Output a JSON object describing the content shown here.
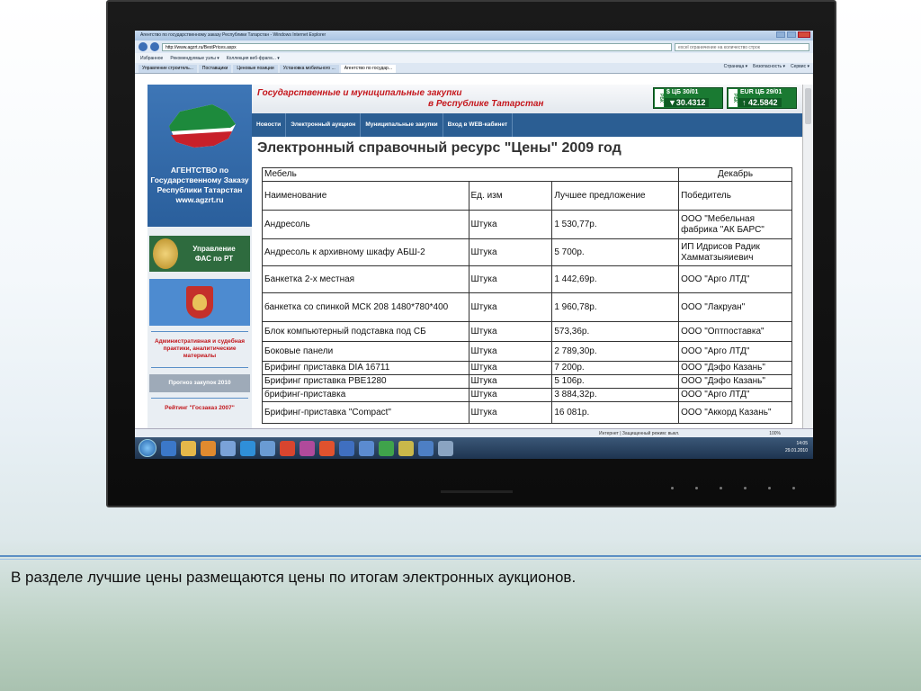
{
  "slide": {
    "caption": "В разделе лучшие цены размещаются цены по итогам электронных аукционов."
  },
  "browser": {
    "window_title": "Агентство по государственному заказу Республики Татарстан - Windows Internet Explorer",
    "url": "http://www.agzrt.ru/BestPrices.aspx",
    "search_text": "excel ограничение на количество строк",
    "favorites": [
      "Избранное",
      "Рекомендуемые узлы ▾",
      "Коллекция веб-фрагм... ▾"
    ],
    "tabs": [
      "Управление строитель...",
      "Поставщики",
      "Ценовые позиции",
      "Установка мобильного ...",
      "Агентство по государ..."
    ],
    "command_items": [
      "Страница ▾",
      "Безопасность ▾",
      "Сервис ▾"
    ],
    "status_text": "Интернет | Защищенный режим: выкл.",
    "zoom": "100%"
  },
  "taskbar": {
    "time": "14:05",
    "date": "29.01.2010"
  },
  "site": {
    "banner_line1": "Государственные и муниципальные закупки",
    "banner_line2": "в Республике Татарстан",
    "rates": [
      {
        "label": "$ ЦБ",
        "date": "30/01",
        "value": "▼30.4312",
        "tag": "РБК"
      },
      {
        "label": "EUR ЦБ",
        "date": "29/01",
        "value": "↑ 42.5842",
        "tag": "РБК"
      }
    ],
    "menu": [
      "Новости",
      "Электронный аукцион",
      "Муниципальные закупки",
      "Вход в WEB-кабинет"
    ],
    "sidebar": {
      "agency_lines": [
        "АГЕНТСТВО по",
        "Государственному Заказу",
        "Республики Татарстан",
        "www.agzrt.ru"
      ],
      "fas_lines": [
        "Управление",
        "ФАС по РТ"
      ],
      "links": [
        "Административная и судебная практики, аналитические материалы",
        "Прогноз закупок 2010",
        "Рейтинг \"Госзаказ 2007\""
      ]
    },
    "page_title": "Электронный справочный ресурс \"Цены\" 2009 год",
    "table": {
      "category": "Мебель",
      "month": "Декабрь",
      "headers": [
        "Наименование",
        "Ед. изм",
        "Лучшее предложение",
        "Победитель"
      ],
      "rows": [
        [
          "Андресоль",
          "Штука",
          "1 530,77р.",
          "ООО \"Мебельная фабрика \"АК БАРС\""
        ],
        [
          "Андресоль к архивному шкафу АБШ-2",
          "Штука",
          "5 700р.",
          "ИП Идрисов Радик Хамматзыяиевич"
        ],
        [
          "Банкетка 2-х местная",
          "Штука",
          "1 442,69р.",
          "ООО \"Арго ЛТД\""
        ],
        [
          "банкетка со спинкой МСК 208 1480*780*400",
          "Штука",
          "1 960,78р.",
          "ООО \"Лакруан\""
        ],
        [
          "Блок компьютерный подставка под СБ",
          "Штука",
          "573,36р.",
          "ООО \"Оптпоставка\""
        ],
        [
          "Боковые панели",
          "Штука",
          "2 789,30р.",
          "ООО \"Арго ЛТД\""
        ],
        [
          "Брифинг приставка DIA 16711",
          "Штука",
          "7 200р.",
          "ООО \"Дэфо Казань\""
        ],
        [
          "Брифинг приставка PBE1280",
          "Штука",
          "5 106р.",
          "ООО \"Дэфо Казань\""
        ],
        [
          "брифинг-приставка",
          "Штука",
          "3 884,32р.",
          "ООО \"Арго ЛТД\""
        ],
        [
          "Брифинг-приставка \"Compact\"",
          "Штука",
          "16 081р.",
          "ООО \"Аккорд Казань\""
        ]
      ]
    }
  },
  "colors": {
    "site_menu": "#2b5e93",
    "sidebar_blue": "#2a5f9c",
    "banner_red": "#c4161c",
    "rate_green": "#1a7a32"
  }
}
